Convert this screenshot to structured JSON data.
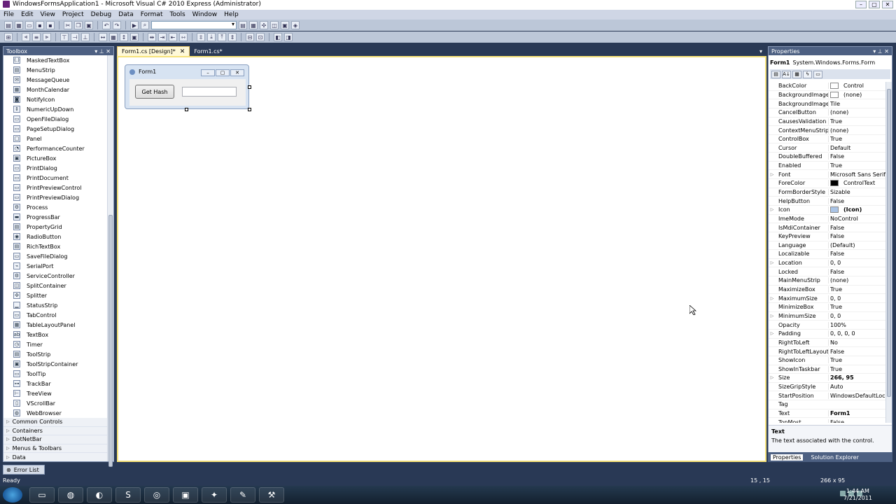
{
  "window": {
    "title": "WindowsFormsApplication1 - Microsoft Visual C# 2010 Express (Administrator)"
  },
  "menu": [
    "File",
    "Edit",
    "View",
    "Project",
    "Debug",
    "Data",
    "Format",
    "Tools",
    "Window",
    "Help"
  ],
  "toolbox": {
    "title": "Toolbox",
    "items": [
      {
        "label": "MaskedTextBox",
        "icon": "(.)"
      },
      {
        "label": "MenuStrip",
        "icon": "▤"
      },
      {
        "label": "MessageQueue",
        "icon": "✉"
      },
      {
        "label": "MonthCalendar",
        "icon": "▦"
      },
      {
        "label": "NotifyIcon",
        "icon": "◙"
      },
      {
        "label": "NumericUpDown",
        "icon": "⇕"
      },
      {
        "label": "OpenFileDialog",
        "icon": "▭"
      },
      {
        "label": "PageSetupDialog",
        "icon": "▭"
      },
      {
        "label": "Panel",
        "icon": "□"
      },
      {
        "label": "PerformanceCounter",
        "icon": "◔"
      },
      {
        "label": "PictureBox",
        "icon": "▣"
      },
      {
        "label": "PrintDialog",
        "icon": "▭"
      },
      {
        "label": "PrintDocument",
        "icon": "▭"
      },
      {
        "label": "PrintPreviewControl",
        "icon": "▭"
      },
      {
        "label": "PrintPreviewDialog",
        "icon": "▭"
      },
      {
        "label": "Process",
        "icon": "⚙"
      },
      {
        "label": "ProgressBar",
        "icon": "▬"
      },
      {
        "label": "PropertyGrid",
        "icon": "▤"
      },
      {
        "label": "RadioButton",
        "icon": "◉"
      },
      {
        "label": "RichTextBox",
        "icon": "▤"
      },
      {
        "label": "SaveFileDialog",
        "icon": "▭"
      },
      {
        "label": "SerialPort",
        "icon": "⌁"
      },
      {
        "label": "ServiceController",
        "icon": "⚙"
      },
      {
        "label": "SplitContainer",
        "icon": "◫"
      },
      {
        "label": "Splitter",
        "icon": "✣"
      },
      {
        "label": "StatusStrip",
        "icon": "▁"
      },
      {
        "label": "TabControl",
        "icon": "▭"
      },
      {
        "label": "TableLayoutPanel",
        "icon": "▦"
      },
      {
        "label": "TextBox",
        "icon": "ab"
      },
      {
        "label": "Timer",
        "icon": "◷"
      },
      {
        "label": "ToolStrip",
        "icon": "▤"
      },
      {
        "label": "ToolStripContainer",
        "icon": "▣"
      },
      {
        "label": "ToolTip",
        "icon": "▭"
      },
      {
        "label": "TrackBar",
        "icon": "⊶"
      },
      {
        "label": "TreeView",
        "icon": "⊢"
      },
      {
        "label": "VScrollBar",
        "icon": "▯"
      },
      {
        "label": "WebBrowser",
        "icon": "◍"
      }
    ],
    "categories": [
      "Common Controls",
      "Containers",
      "DotNetBar",
      "Menus & Toolbars",
      "Data"
    ]
  },
  "tabs": [
    {
      "label": "Form1.cs [Design]*"
    },
    {
      "label": "Form1.cs*"
    }
  ],
  "form": {
    "title": "Form1",
    "button_label": "Get Hash"
  },
  "properties": {
    "title": "Properties",
    "object_name": "Form1",
    "object_type": "System.Windows.Forms.Form",
    "rows": [
      {
        "name": "BackColor",
        "value": "Control",
        "swatch": "#ffffff"
      },
      {
        "name": "BackgroundImage",
        "value": "(none)",
        "swatch": "#ffffff"
      },
      {
        "name": "BackgroundImageL",
        "value": "Tile"
      },
      {
        "name": "CancelButton",
        "value": "(none)"
      },
      {
        "name": "CausesValidation",
        "value": "True"
      },
      {
        "name": "ContextMenuStrip",
        "value": "(none)"
      },
      {
        "name": "ControlBox",
        "value": "True"
      },
      {
        "name": "Cursor",
        "value": "Default"
      },
      {
        "name": "DoubleBuffered",
        "value": "False"
      },
      {
        "name": "Enabled",
        "value": "True"
      },
      {
        "name": "Font",
        "value": "Microsoft Sans Serif, 8",
        "expand": true
      },
      {
        "name": "ForeColor",
        "value": "ControlText",
        "swatch": "#000000"
      },
      {
        "name": "FormBorderStyle",
        "value": "Sizable"
      },
      {
        "name": "HelpButton",
        "value": "False"
      },
      {
        "name": "Icon",
        "value": "(Icon)",
        "expand": true,
        "bold": true,
        "swatch": "#aac4e6"
      },
      {
        "name": "ImeMode",
        "value": "NoControl"
      },
      {
        "name": "IsMdiContainer",
        "value": "False"
      },
      {
        "name": "KeyPreview",
        "value": "False"
      },
      {
        "name": "Language",
        "value": "(Default)"
      },
      {
        "name": "Localizable",
        "value": "False"
      },
      {
        "name": "Location",
        "value": "0, 0",
        "expand": true
      },
      {
        "name": "Locked",
        "value": "False"
      },
      {
        "name": "MainMenuStrip",
        "value": "(none)"
      },
      {
        "name": "MaximizeBox",
        "value": "True"
      },
      {
        "name": "MaximumSize",
        "value": "0, 0",
        "expand": true
      },
      {
        "name": "MinimizeBox",
        "value": "True"
      },
      {
        "name": "MinimumSize",
        "value": "0, 0",
        "expand": true
      },
      {
        "name": "Opacity",
        "value": "100%"
      },
      {
        "name": "Padding",
        "value": "0, 0, 0, 0",
        "expand": true
      },
      {
        "name": "RightToLeft",
        "value": "No"
      },
      {
        "name": "RightToLeftLayout",
        "value": "False"
      },
      {
        "name": "ShowIcon",
        "value": "True"
      },
      {
        "name": "ShowInTaskbar",
        "value": "True"
      },
      {
        "name": "Size",
        "value": "266, 95",
        "expand": true,
        "bold": true
      },
      {
        "name": "SizeGripStyle",
        "value": "Auto"
      },
      {
        "name": "StartPosition",
        "value": "WindowsDefaultLocat"
      },
      {
        "name": "Tag",
        "value": ""
      },
      {
        "name": "Text",
        "value": "Form1",
        "bold": true
      },
      {
        "name": "TopMost",
        "value": "False"
      }
    ],
    "description_title": "Text",
    "description": "The text associated with the control.",
    "bottom_tabs": [
      "Properties",
      "Solution Explorer"
    ]
  },
  "error_list": "Error List",
  "status": {
    "ready": "Ready",
    "position": "15 , 15",
    "size": "266 x 95"
  },
  "clock": {
    "time": "1:44 AM",
    "date": "7/21/2011"
  }
}
